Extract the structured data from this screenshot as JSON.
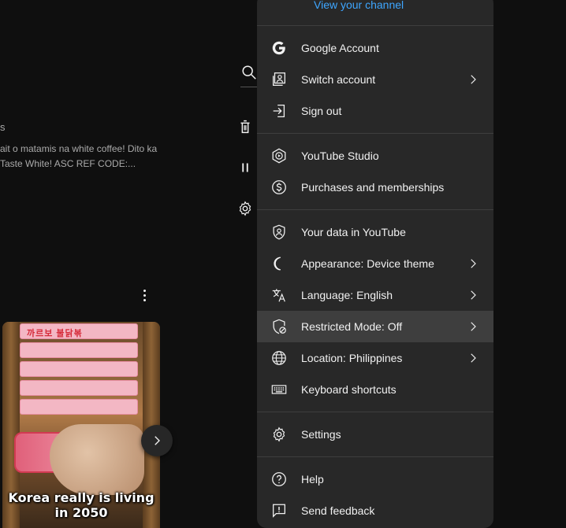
{
  "background": {
    "title_fragment": "s",
    "description_lines": [
      "ait o matamis na white coffee! Dito ka",
      "Taste White! ASC REF CODE:..."
    ],
    "thumbnail": {
      "caption_lines": [
        "Korea really is living",
        "in 2050"
      ],
      "package_text": "까르보 불닭볶"
    }
  },
  "icons": {
    "search": "search-icon",
    "delete": "trash-icon",
    "pause": "pause-icon",
    "settings": "gear-icon",
    "more": "more-vert-icon",
    "next": "chevron-right-icon"
  },
  "menu": {
    "view_channel_label": "View your channel",
    "sections": [
      [
        {
          "icon": "google-icon",
          "label": "Google Account",
          "chevron": false
        },
        {
          "icon": "switch-account-icon",
          "label": "Switch account",
          "chevron": true
        },
        {
          "icon": "sign-out-icon",
          "label": "Sign out",
          "chevron": false
        }
      ],
      [
        {
          "icon": "youtube-studio-icon",
          "label": "YouTube Studio",
          "chevron": false
        },
        {
          "icon": "dollar-icon",
          "label": "Purchases and memberships",
          "chevron": false
        }
      ],
      [
        {
          "icon": "shield-person-icon",
          "label": "Your data in YouTube",
          "chevron": false
        },
        {
          "icon": "moon-icon",
          "label": "Appearance: Device theme",
          "chevron": true
        },
        {
          "icon": "translate-icon",
          "label": "Language: English",
          "chevron": true
        },
        {
          "icon": "restricted-icon",
          "label": "Restricted Mode: Off",
          "chevron": true,
          "active": true
        },
        {
          "icon": "globe-icon",
          "label": "Location: Philippines",
          "chevron": true
        },
        {
          "icon": "keyboard-icon",
          "label": "Keyboard shortcuts",
          "chevron": false
        }
      ],
      [
        {
          "icon": "gear-icon",
          "label": "Settings",
          "chevron": false
        }
      ],
      [
        {
          "icon": "help-icon",
          "label": "Help",
          "chevron": false
        },
        {
          "icon": "feedback-icon",
          "label": "Send feedback",
          "chevron": false
        }
      ]
    ]
  },
  "colors": {
    "page_bg": "#0f0f0f",
    "menu_bg": "#282828",
    "menu_hover": "#3e3e3e",
    "link": "#3ea6ff",
    "text": "#f1f1f1",
    "secondary_text": "#aaaaaa"
  }
}
